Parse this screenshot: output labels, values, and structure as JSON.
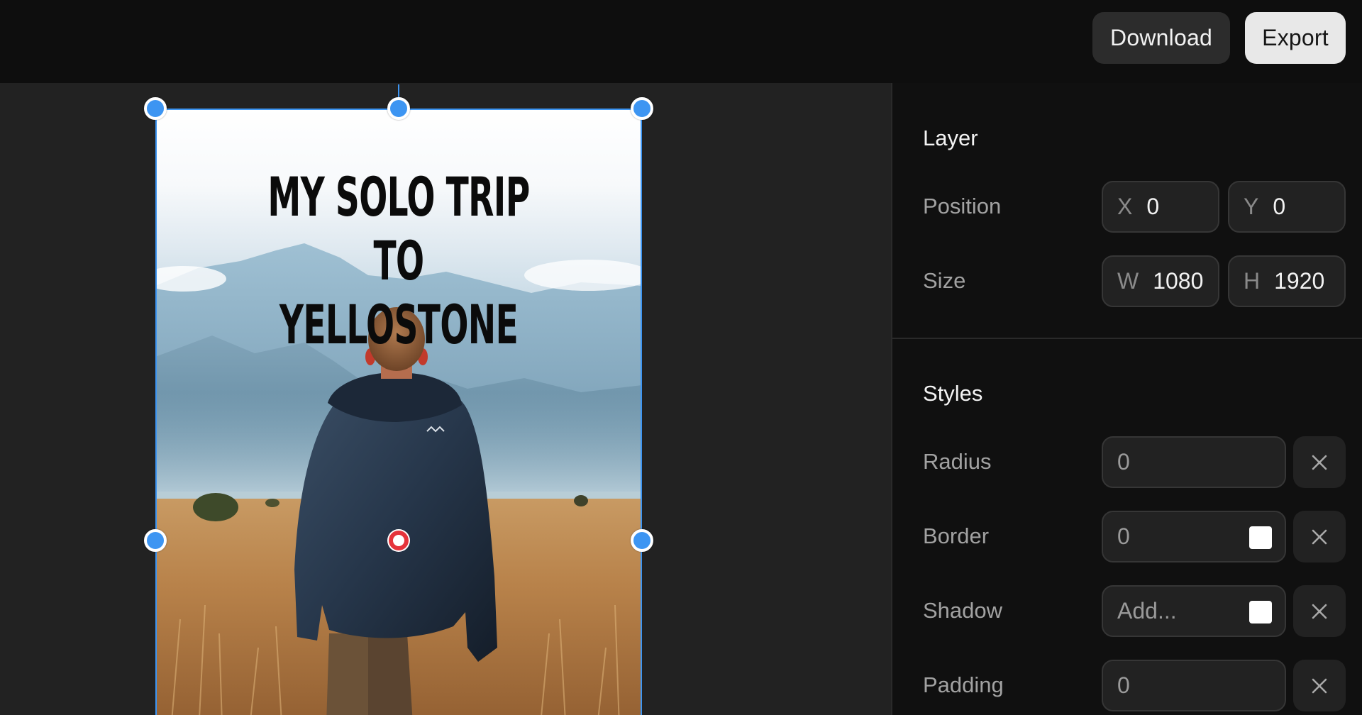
{
  "toolbar": {
    "download_label": "Download",
    "export_label": "Export"
  },
  "canvas": {
    "artboard": {
      "headline_line1": "MY SOLO TRIP TO",
      "headline_line2": "YELLOSTONE",
      "image_description": "person in dark jacket walking through a golden grass field toward misty blue mountains"
    }
  },
  "panel": {
    "layer": {
      "title": "Layer",
      "position": {
        "label": "Position",
        "x_axis": "X",
        "x_value": "0",
        "y_axis": "Y",
        "y_value": "0"
      },
      "size": {
        "label": "Size",
        "w_axis": "W",
        "w_value": "1080",
        "h_axis": "H",
        "h_value": "1920"
      }
    },
    "styles": {
      "title": "Styles",
      "radius": {
        "label": "Radius",
        "value": "0"
      },
      "border": {
        "label": "Border",
        "value": "0",
        "swatch_color": "#ffffff"
      },
      "shadow": {
        "label": "Shadow",
        "placeholder": "Add...",
        "swatch_color": "#ffffff"
      },
      "padding": {
        "label": "Padding",
        "value": "0"
      }
    }
  },
  "colors": {
    "selection": "#3d95f2",
    "center_point": "#e5333b",
    "topbar_bg": "#0e0e0e",
    "panel_bg": "#101010",
    "canvas_bg": "#222222"
  }
}
